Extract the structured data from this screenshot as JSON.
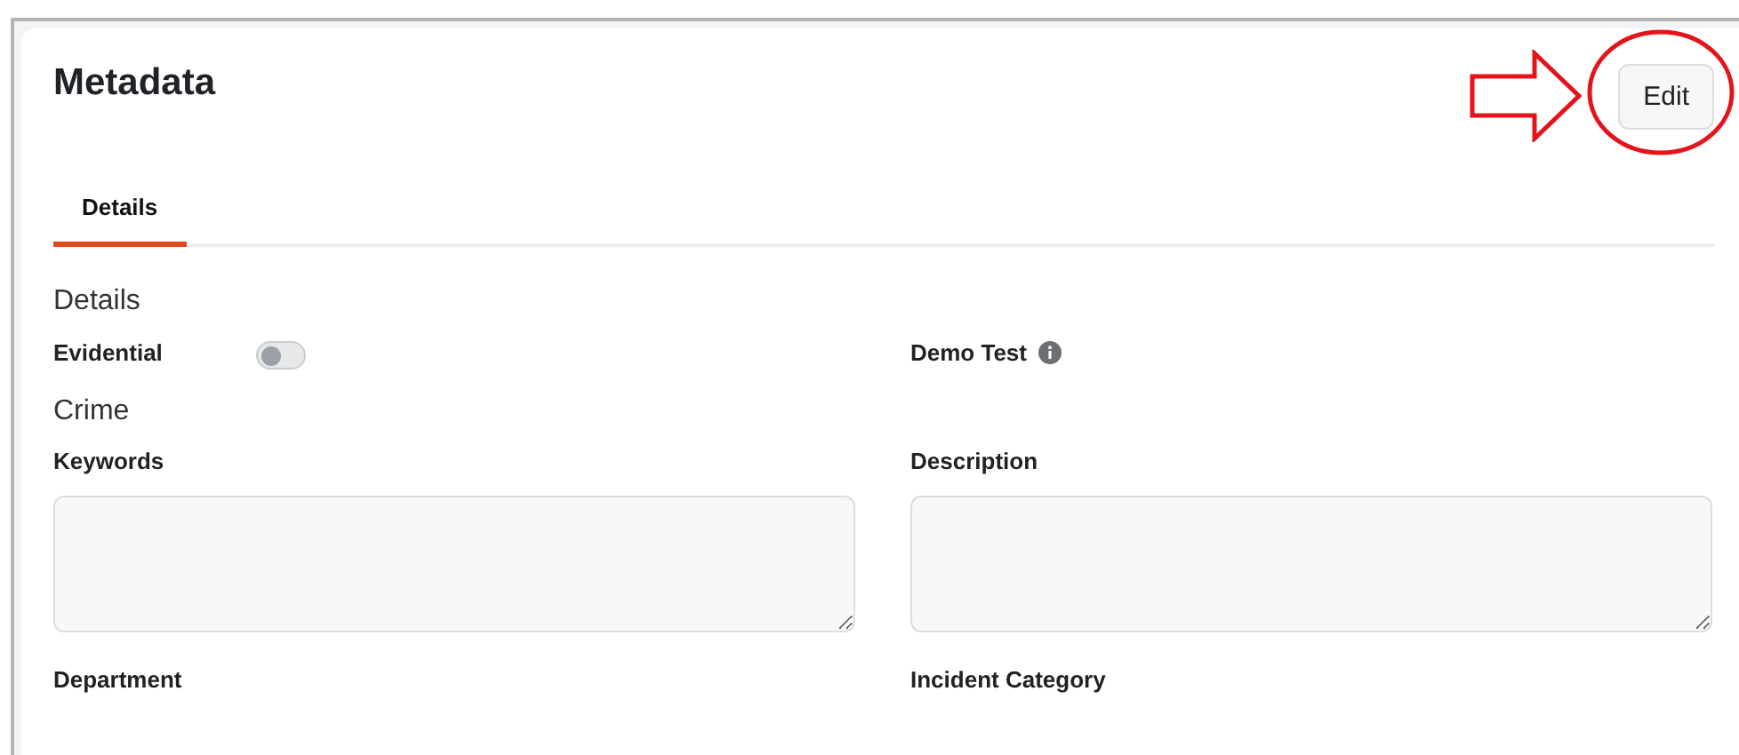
{
  "title": "Metadata",
  "edit_button": "Edit",
  "tabs": [
    {
      "label": "Details",
      "selected": true
    }
  ],
  "sections": [
    {
      "title": "Details",
      "fields": [
        {
          "kind": "toggle",
          "label": "Evidential",
          "on": false
        },
        {
          "kind": "info",
          "label": "Demo Test"
        }
      ]
    },
    {
      "title": "Crime",
      "fields": [
        {
          "kind": "textarea",
          "label": "Keywords"
        },
        {
          "kind": "textarea",
          "label": "Description"
        },
        {
          "kind": "label",
          "label": "Department"
        },
        {
          "kind": "label",
          "label": "Incident Category"
        }
      ]
    }
  ]
}
